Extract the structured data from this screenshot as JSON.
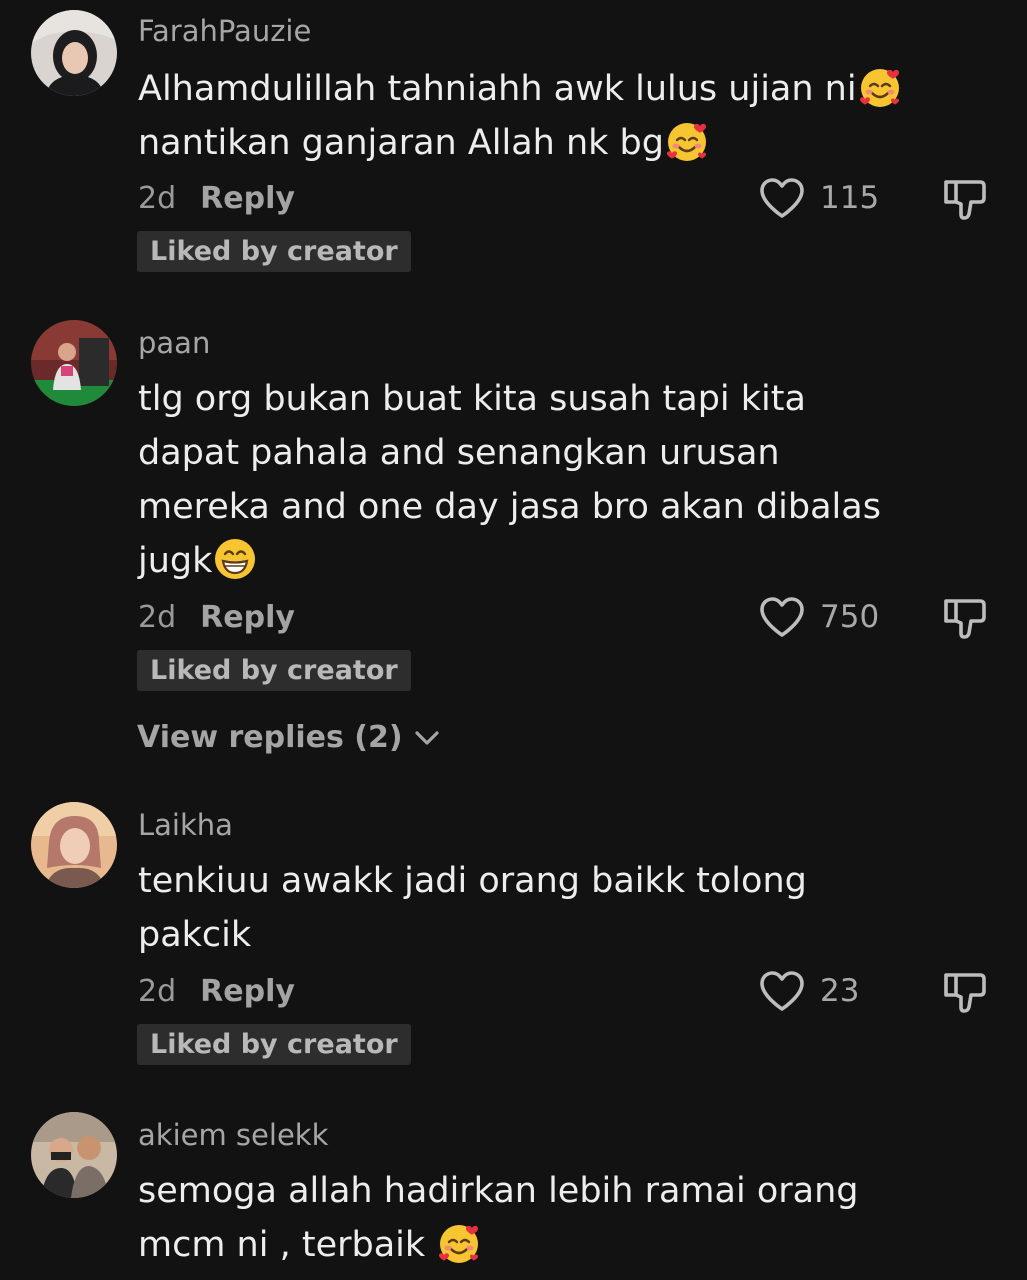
{
  "comments": [
    {
      "username": "FarahPauzie",
      "lines": [
        "Alhamdulillah tahniahh awk lulus ujian ni",
        "nantikan ganjaran Allah nk bg"
      ],
      "emojis": [
        "smiling-face-with-hearts",
        "smiling-face-with-hearts"
      ],
      "time": "2d",
      "reply_label": "Reply",
      "likes": "115",
      "badge": "Liked by creator"
    },
    {
      "username": "paan",
      "lines": [
        "tlg org bukan buat kita susah tapi kita",
        "dapat pahala and senangkan urusan",
        "mereka and one day jasa bro akan dibalas",
        "jugk"
      ],
      "emojis": [
        "grinning-face"
      ],
      "time": "2d",
      "reply_label": "Reply",
      "likes": "750",
      "badge": "Liked by creator",
      "view_replies": "View replies (2)"
    },
    {
      "username": "Laikha",
      "lines": [
        "tenkiuu awakk jadi orang baikk tolong",
        "pakcik"
      ],
      "time": "2d",
      "reply_label": "Reply",
      "likes": "23",
      "badge": "Liked by creator"
    },
    {
      "username": "akiem selekk",
      "lines": [
        "semoga allah hadirkan lebih ramai orang",
        "mcm ni , terbaik "
      ],
      "emojis": [
        "smiling-face-with-hearts"
      ],
      "time": "",
      "reply_label": "",
      "likes": ""
    }
  ],
  "icons": {
    "like": "heart-icon",
    "dislike": "thumbs-down-icon",
    "expand": "chevron-down-icon"
  },
  "colors": {
    "background": "#121212",
    "text": "#ededed",
    "secondary": "#a6a6a6",
    "badge_bg": "#2d2d2d",
    "emoji_yellow": "#f7c531"
  }
}
